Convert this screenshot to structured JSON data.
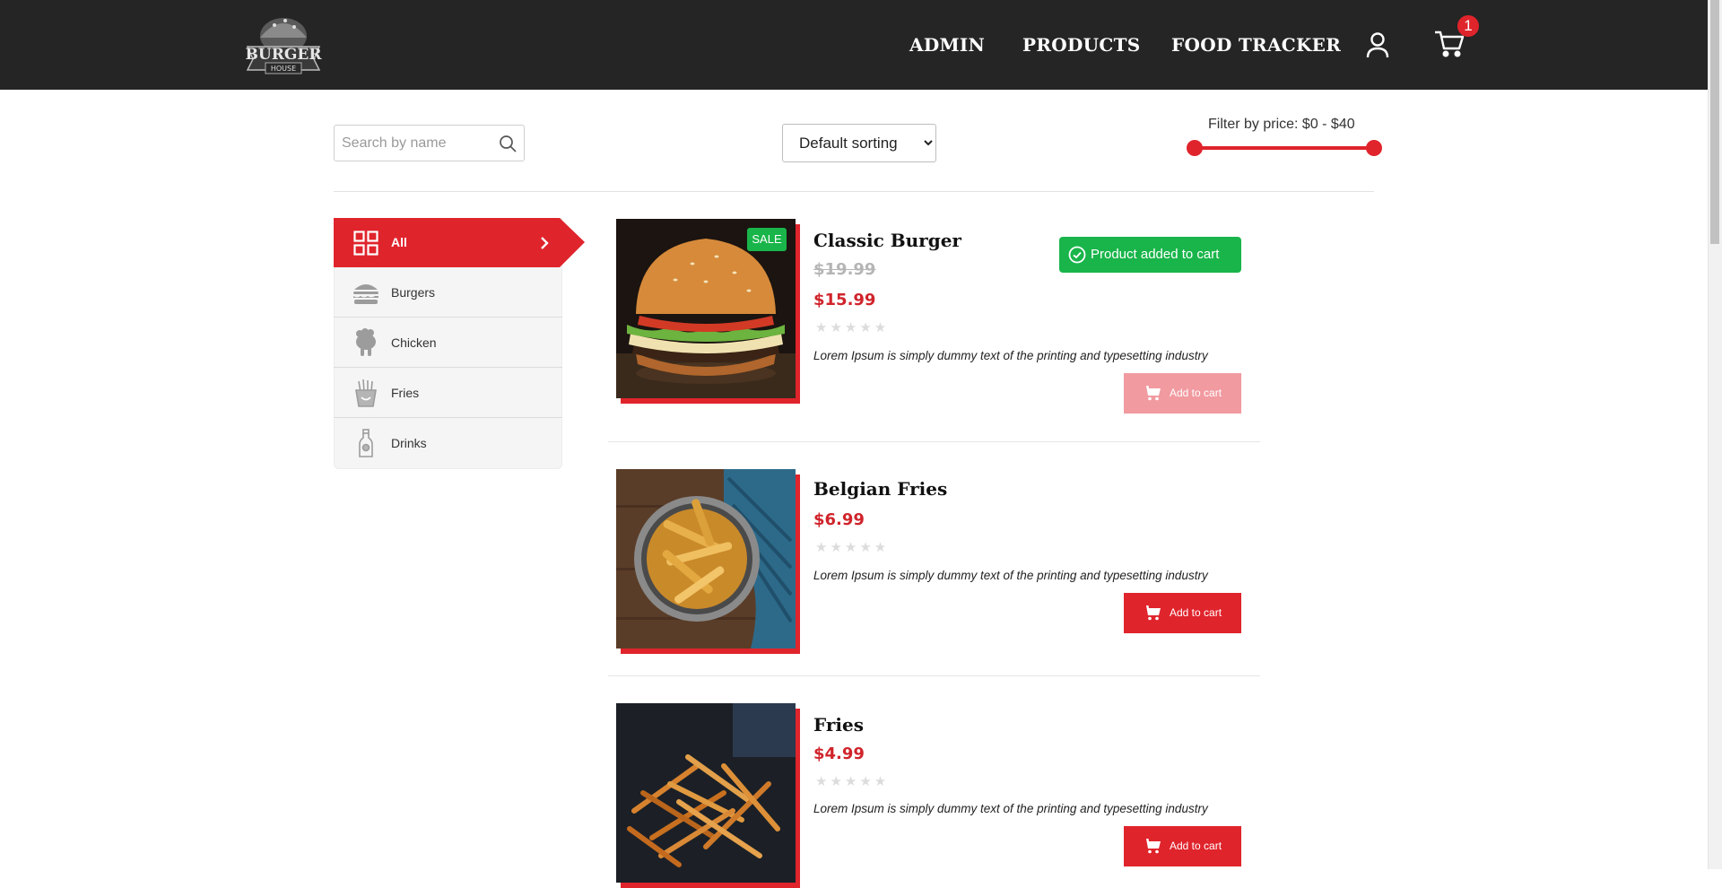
{
  "brand": {
    "logo_top": "BURGER",
    "logo_bottom": "HOUSE"
  },
  "nav": {
    "items": [
      "ADMIN",
      "PRODUCTS",
      "FOOD TRACKER"
    ],
    "cart_count": "1"
  },
  "filters": {
    "search_placeholder": "Search by name",
    "sort_selected": "Default sorting",
    "price_label": "Filter by price: $0 - $40",
    "price_min": 0,
    "price_max": 40
  },
  "categories": [
    {
      "label": "All",
      "icon": "grid-icon",
      "active": true
    },
    {
      "label": "Burgers",
      "icon": "burger-icon",
      "active": false
    },
    {
      "label": "Chicken",
      "icon": "chicken-icon",
      "active": false
    },
    {
      "label": "Fries",
      "icon": "fries-icon",
      "active": false
    },
    {
      "label": "Drinks",
      "icon": "bottle-icon",
      "active": false
    }
  ],
  "products": [
    {
      "name": "Classic Burger",
      "old_price": "$19.99",
      "price": "$15.99",
      "rating": 0,
      "stars": "★★★★★",
      "desc": "Lorem Ipsum is simply dummy text of the printing and typesetting industry",
      "button": "Add to cart",
      "badge": "SALE",
      "button_disabled": true
    },
    {
      "name": "Belgian Fries",
      "price": "$6.99",
      "rating": 0,
      "stars": "★★★★★",
      "desc": "Lorem Ipsum is simply dummy text of the printing and typesetting industry",
      "button": "Add to cart",
      "button_disabled": false
    },
    {
      "name": "Fries",
      "price": "$4.99",
      "rating": 0,
      "stars": "★★★★★",
      "desc": "Lorem Ipsum is simply dummy text of the printing and typesetting industry",
      "button": "Add to cart",
      "button_disabled": false
    }
  ],
  "toast": {
    "message": "Product added to cart"
  },
  "colors": {
    "accent": "#e0242c",
    "success": "#19b54a",
    "header": "#252525"
  }
}
